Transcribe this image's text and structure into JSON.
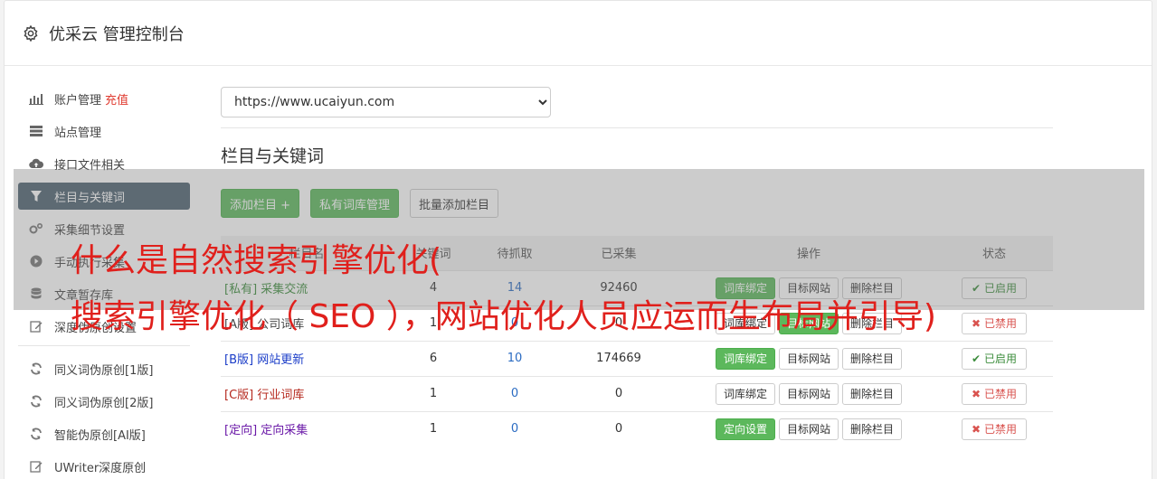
{
  "header": {
    "title": "优采云 管理控制台"
  },
  "sidebar": {
    "items": [
      {
        "label": "账户管理",
        "accent": "充值",
        "icon": "bar-chart-icon"
      },
      {
        "label": "站点管理",
        "icon": "server-icon"
      },
      {
        "label": "接口文件相关",
        "icon": "cloud-upload-icon"
      },
      {
        "label": "栏目与关键词",
        "icon": "filter-icon",
        "active": true
      },
      {
        "label": "采集细节设置",
        "icon": "gears-icon"
      },
      {
        "label": "手动执行采集",
        "icon": "play-icon"
      },
      {
        "label": "文章暂存库",
        "icon": "database-icon"
      },
      {
        "label": "深度伪原创设置",
        "icon": "edit-icon"
      }
    ],
    "items2": [
      {
        "label": "同义词伪原创[1版]",
        "icon": "refresh-icon"
      },
      {
        "label": "同义词伪原创[2版]",
        "icon": "refresh-icon"
      },
      {
        "label": "智能伪原创[AI版]",
        "icon": "refresh-icon"
      },
      {
        "label": "UWriter深度原创",
        "icon": "edit-icon"
      }
    ]
  },
  "main": {
    "site_select": "https://www.ucaiyun.com",
    "section_title": "栏目与关键词",
    "buttons": {
      "add_column": "添加栏目 +",
      "private_lib": "私有词库管理",
      "batch_add": "批量添加栏目"
    },
    "table": {
      "headers": {
        "name": "栏目名",
        "keywords": "关键词",
        "pending": "待抓取",
        "collected": "已采集",
        "ops": "操作",
        "status": "状态"
      },
      "rows": [
        {
          "tag": "[私有]",
          "name": "采集交流",
          "keywords": "4",
          "pending": "14",
          "collected": "92460",
          "bind": "词库绑定",
          "target": "目标网站",
          "del": "删除栏目",
          "status": "已启用"
        },
        {
          "tag": "[A版]",
          "name": "公司词库",
          "keywords": "1",
          "pending": "0",
          "collected": "0",
          "bind": "词库绑定",
          "target": "目标网站",
          "del": "删除栏目",
          "status": "已禁用"
        },
        {
          "tag": "[B版]",
          "name": "网站更新",
          "keywords": "6",
          "pending": "10",
          "collected": "174669",
          "bind": "词库绑定",
          "target": "目标网站",
          "del": "删除栏目",
          "status": "已启用"
        },
        {
          "tag": "[C版]",
          "name": "行业词库",
          "keywords": "1",
          "pending": "0",
          "collected": "0",
          "bind": "词库绑定",
          "target": "目标网站",
          "del": "删除栏目",
          "status": "已禁用"
        },
        {
          "tag": "[定向]",
          "name": "定向采集",
          "keywords": "1",
          "pending": "0",
          "collected": "0",
          "bind": "定向设置",
          "target": "目标网站",
          "del": "删除栏目",
          "status": "已禁用"
        }
      ]
    }
  },
  "overlay": {
    "line1": "什么是自然搜索引擎优化(",
    "line2": "搜索引擎优化（ SEO ），网站优化人员应运而生布局并引导)"
  },
  "colors": {
    "active_bg": "#4d6170",
    "green": "#5cb85c",
    "red": "#e0201c"
  }
}
